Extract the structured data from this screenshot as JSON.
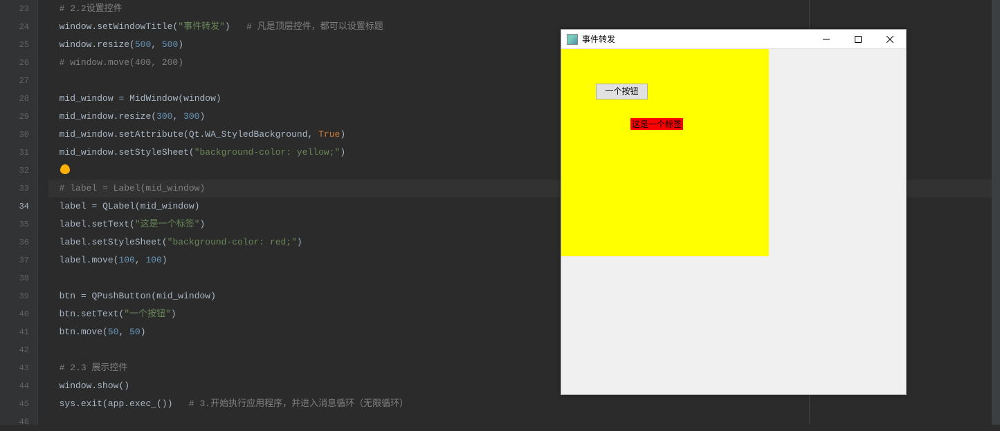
{
  "gutter": {
    "start": 23,
    "end": 46,
    "active": 34
  },
  "code": {
    "l23": {
      "comment": "# 2.2设置控件"
    },
    "l24": {
      "obj": "window",
      "method": "setWindowTitle",
      "str": "\"事件转发\"",
      "tail_comment": "# 凡是顶层控件，都可以设置标题"
    },
    "l25": {
      "obj": "window",
      "method": "resize",
      "n1": "500",
      "n2": "500"
    },
    "l26": {
      "comment": "# window.move(400, 200)"
    },
    "l28": {
      "lhs": "mid_window",
      "rhs_cls": "MidWindow",
      "arg": "window"
    },
    "l29": {
      "obj": "mid_window",
      "method": "resize",
      "n1": "300",
      "n2": "300"
    },
    "l30": {
      "obj": "mid_window",
      "method": "setAttribute",
      "arg1": "Qt.WA_StyledBackground",
      "arg2": "True"
    },
    "l31": {
      "obj": "mid_window",
      "method": "setStyleSheet",
      "str": "\"background-color: yellow;\""
    },
    "l33": {
      "comment": "# label = Label(mid_window)"
    },
    "l34": {
      "lhs": "label",
      "rhs_cls": "QLabel",
      "arg": "mid_window"
    },
    "l35": {
      "obj": "label",
      "method": "setText",
      "str": "\"这是一个标签\""
    },
    "l36": {
      "obj": "label",
      "method": "setStyleSheet",
      "str": "\"background-color: red;\""
    },
    "l37": {
      "obj": "label",
      "method": "move",
      "n1": "100",
      "n2": "100"
    },
    "l39": {
      "lhs": "btn",
      "rhs_cls": "QPushButton",
      "arg": "mid_window"
    },
    "l40": {
      "obj": "btn",
      "method": "setText",
      "str": "\"一个按钮\""
    },
    "l41": {
      "obj": "btn",
      "method": "move",
      "n1": "50",
      "n2": "50"
    },
    "l43": {
      "comment": "# 2.3 展示控件"
    },
    "l44": {
      "obj": "window",
      "method": "show"
    },
    "l45": {
      "prefix": "sys",
      "method": "exit",
      "inner_obj": "app",
      "inner_method": "exec_",
      "tail_comment": "# 3.开始执行应用程序，并进入消息循环（无限循环）"
    }
  },
  "qt_window": {
    "title": "事件转发",
    "button_label": "一个按钮",
    "label_text": "这是一个标签",
    "colors": {
      "mid_bg": "yellow",
      "label_bg": "red"
    }
  }
}
